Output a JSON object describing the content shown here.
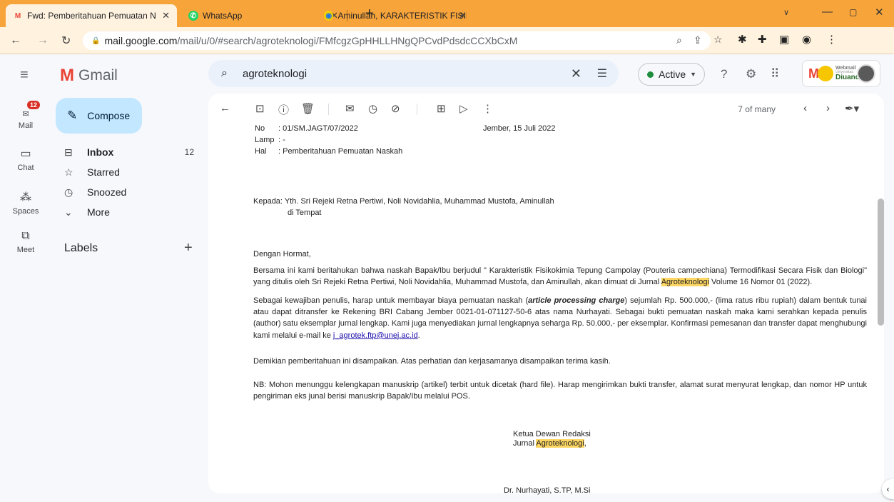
{
  "browser": {
    "tabs": [
      {
        "title": "Fwd: Pemberitahuan Pemuatan N",
        "close": "✕"
      },
      {
        "title": "WhatsApp",
        "close": "✕"
      },
      {
        "title": "Aminullah, KARAKTERISTIK FISIK",
        "close": "✕"
      }
    ],
    "url_host": "mail.google.com",
    "url_path": "/mail/u/0/#search/agroteknologi/FMfcgzGpHHLLHNgQPCvdPdsdcCCXbCxM"
  },
  "gmail": {
    "brand": "Gmail",
    "search_value": "agroteknologi",
    "status": "Active",
    "account": {
      "line1": "Webmail",
      "line2": "Universitas",
      "line3": "Diuanda"
    }
  },
  "rail": [
    {
      "label": "Mail",
      "badge": "12"
    },
    {
      "label": "Chat"
    },
    {
      "label": "Spaces"
    },
    {
      "label": "Meet"
    }
  ],
  "sidebar": {
    "compose": "Compose",
    "items": [
      {
        "label": "Inbox",
        "count": "12"
      },
      {
        "label": "Starred"
      },
      {
        "label": "Snoozed"
      },
      {
        "label": "More"
      }
    ],
    "labels_title": "Labels"
  },
  "toolbar": {
    "pager": "7 of many"
  },
  "letter": {
    "no_label": "No",
    "no_value": ": 01/SM.JAGT/07/2022",
    "date": "Jember, 15 Juli 2022",
    "lamp_label": "Lamp",
    "lamp_value": ": -",
    "hal_label": "Hal",
    "hal_value": ": Pemberitahuan Pemuatan Naskah",
    "to_line": "Kepada: Yth. Sri Rejeki Retna Pertiwi, Noli Novidahlia, Muhammad Mustofa, Aminullah",
    "to_place": "di Tempat",
    "greeting": "Dengan Hormat,",
    "p1_a": "Bersama ini kami beritahukan bahwa naskah Bapak/Ibu berjudul \" Karakteristik Fisikokimia Tepung Campolay (Pouteria campechiana) Termodifikasi Secara Fisik dan Biologi\"  yang ditulis oleh Sri Rejeki Retna Pertiwi, Noli Novidahlia, Muhammad Mustofa, dan Aminullah, akan dimuat di Jurnal ",
    "p1_hl": "Agroteknologi",
    "p1_b": " Volume 16 Nomor 01 (2022).",
    "p2_a": "Sebagai kewajiban penulis, harap untuk membayar biaya pemuatan naskah (",
    "p2_it": "article processing charge",
    "p2_b": ") sejumlah Rp. 500.000,- (lima ratus ribu rupiah) dalam bentuk tunai atau dapat ditransfer ke Rekening BRI Cabang Jember 0021-01-071127-50-6 atas nama Nurhayati. Sebagai bukti pemuatan naskah maka kami serahkan kepada penulis (author) satu eksemplar jurnal lengkap. Kami juga menyediakan jurnal lengkapnya seharga Rp. 50.000,- per eksemplar. Konfirmasi pemesanan dan transfer dapat menghubungi kami melalui e-mail ke ",
    "p2_link": "j_agrotek.ftp@unej.ac.id",
    "p2_c": ".",
    "p3": "Demikian pemberitahuan ini disampaikan. Atas perhatian dan kerjasamanya disampaikan terima kasih.",
    "p4": "NB: Mohon menunggu kelengkapan manuskrip (artikel) terbit untuk dicetak (hard file). Harap mengirimkan bukti transfer, alamat surat menyurat lengkap, dan nomor HP untuk pengiriman eks junal berisi manuskrip Bapak/Ibu melalui POS.",
    "sig_title": "Ketua Dewan Redaksi",
    "sig_journal_a": "Jurnal ",
    "sig_journal_hl": "Agroteknologi",
    "sig_journal_b": ",",
    "sig_name": "Dr. Nurhayati, S.TP, M.Si"
  },
  "colors": {
    "tabbar": "#f7a43b",
    "highlight": "#fdd663",
    "compose": "#c2e7ff",
    "badge": "#d93025"
  }
}
